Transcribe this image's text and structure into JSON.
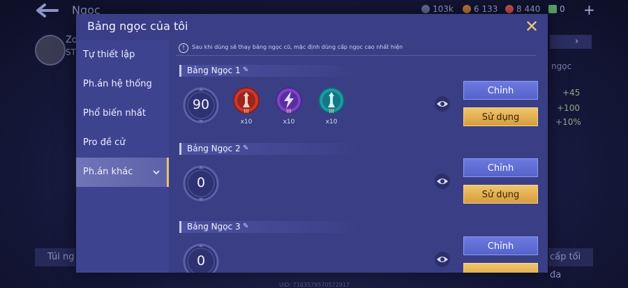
{
  "background": {
    "title": "Ngọc",
    "resources": [
      {
        "value": "103k",
        "color": "#6b6f96"
      },
      {
        "value": "6 133",
        "color": "#c0793a"
      },
      {
        "value": "8 440",
        "color": "#c9544a"
      },
      {
        "value": "0",
        "color": "#5aa06a"
      }
    ],
    "player_name": "Zo",
    "player_sub": "ST",
    "right_label": "ngọc",
    "stats": [
      "+45",
      "+100",
      "+10%"
    ],
    "bottom_left": "Túi ng",
    "bottom_right": "cấp tối đa",
    "uid": "UID: 7163579570572917"
  },
  "dialog": {
    "title": "Bảng ngọc của tôi",
    "close_label": "✕",
    "notice": "Sau khi dùng sẽ thay bảng ngọc cũ, mặc định dùng cấp ngọc cao nhất hiện",
    "sidebar": [
      {
        "label": "Tự thiết lập",
        "active": false
      },
      {
        "label": "Ph.án hệ thống",
        "active": false
      },
      {
        "label": "Phổ biến nhất",
        "active": false
      },
      {
        "label": "Pro đề cử",
        "active": false
      },
      {
        "label": "Ph.án khác",
        "active": true
      }
    ],
    "sets": [
      {
        "name": "Bảng Ngọc 1",
        "level": "90",
        "gems": [
          {
            "color": "#c73a2e",
            "rank": "III",
            "count": "x10",
            "icon": "red-gem-icon"
          },
          {
            "color": "#7a45c4",
            "rank": "III",
            "count": "x10",
            "icon": "purple-gem-icon"
          },
          {
            "color": "#1f9aa6",
            "rank": "III",
            "count": "x10",
            "icon": "teal-gem-icon"
          }
        ],
        "edit_label": "Chỉnh",
        "use_label": "Sử dụng"
      },
      {
        "name": "Bảng Ngọc 2",
        "level": "0",
        "gems": [],
        "edit_label": "Chỉnh",
        "use_label": "Sử dụng"
      },
      {
        "name": "Bảng Ngọc 3",
        "level": "0",
        "gems": [],
        "edit_label": "Chỉnh",
        "use_label": ""
      }
    ]
  }
}
